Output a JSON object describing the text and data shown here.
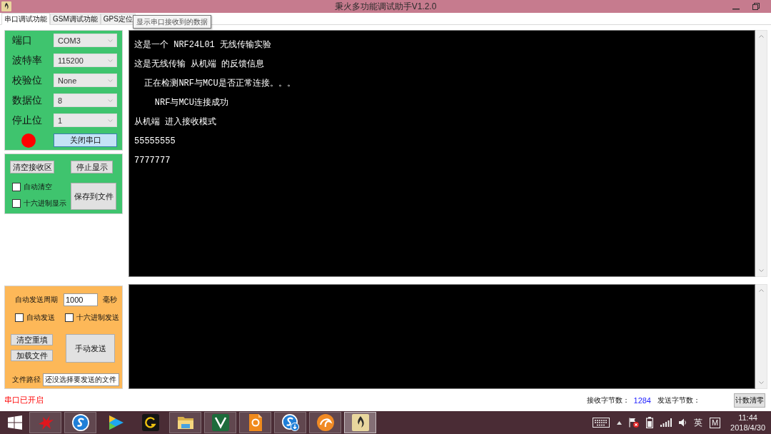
{
  "window": {
    "title": "秉火多功能调试助手V1.2.0"
  },
  "tabs": [
    {
      "label": "串口调试功能",
      "selected": true
    },
    {
      "label": "GSM调试功能",
      "selected": false
    },
    {
      "label": "GPS定位",
      "selected": false
    }
  ],
  "tooltip": {
    "text": "显示串口接收到的数据"
  },
  "serial_settings": {
    "fields": [
      {
        "label": "端口",
        "value": "COM3",
        "disabled": true
      },
      {
        "label": "波特率",
        "value": "115200",
        "disabled": true
      },
      {
        "label": "校验位",
        "value": "None",
        "disabled": true
      },
      {
        "label": "数据位",
        "value": "8",
        "disabled": true
      },
      {
        "label": "停止位",
        "value": "1",
        "disabled": true
      }
    ],
    "indicator": {
      "color": "#ff0000"
    },
    "toggle_button": {
      "label": "关闭串口",
      "focused": true
    }
  },
  "receive_options": {
    "buttons": [
      {
        "label": "清空接收区"
      },
      {
        "label": "停止显示"
      }
    ],
    "checkboxes": [
      {
        "label": "自动清空",
        "checked": false
      },
      {
        "label": "十六进制显示",
        "checked": false
      }
    ],
    "save_button": {
      "label": "保存到文件"
    }
  },
  "receive_area": {
    "lines": [
      "这是一个 NRF24L01 无线传输实验",
      "这是无线传输 从机端 的反馈信息",
      "  正在检测NRF与MCU是否正常连接。。。",
      "    NRF与MCU连接成功",
      "从机端 进入接收模式",
      "55555555",
      "7777777"
    ]
  },
  "send_options": {
    "period": {
      "label": "自动发送周期",
      "value": "1000",
      "unit": "毫秒"
    },
    "checkboxes": [
      {
        "label": "自动发送",
        "checked": false
      },
      {
        "label": "十六进制发送",
        "checked": false
      }
    ],
    "buttons": [
      {
        "label": "清空重填"
      },
      {
        "label": "加载文件"
      }
    ],
    "send_button": {
      "label": "手动发送"
    },
    "file_path": {
      "label": "文件路径",
      "value": "还没选择要发送的文件"
    }
  },
  "status_bar": {
    "status": "串口已开启",
    "received_label": "接收字节数：",
    "received_count": "1284",
    "sent_label": "发送字节数：",
    "reset_button": "计数清零"
  },
  "taskbar": {
    "apps": [
      {
        "kind": "star",
        "running": true,
        "selected": false
      },
      {
        "kind": "sphere",
        "running": true,
        "selected": false
      },
      {
        "kind": "play",
        "running": false,
        "selected": false
      },
      {
        "kind": "hook",
        "running": false,
        "selected": false
      },
      {
        "kind": "folder",
        "running": true,
        "selected": false
      },
      {
        "kind": "vtile",
        "running": true,
        "selected": false
      },
      {
        "kind": "document",
        "running": true,
        "selected": false
      },
      {
        "kind": "download",
        "running": true,
        "selected": false
      },
      {
        "kind": "swirl",
        "running": true,
        "selected": false
      },
      {
        "kind": "flame",
        "running": true,
        "selected": true
      }
    ],
    "tray": {
      "language": "英",
      "ime_mode": "M",
      "time": "11:44",
      "date": "2018/4/30"
    }
  }
}
